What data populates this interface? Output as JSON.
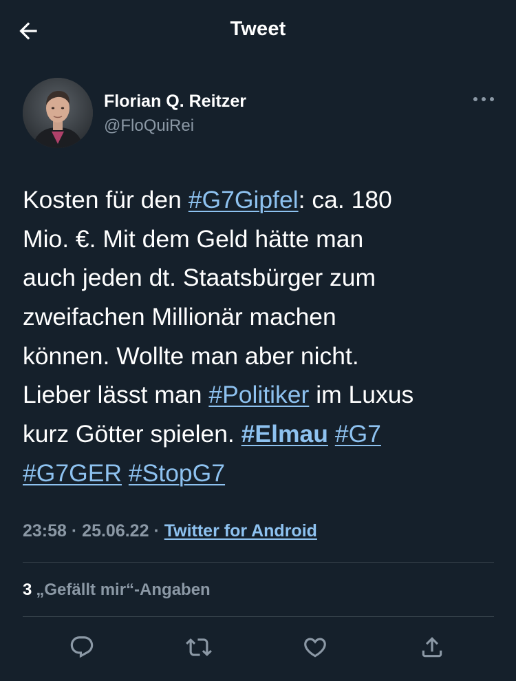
{
  "header": {
    "title": "Tweet",
    "back_icon": "arrow-left-icon"
  },
  "author": {
    "name": "Florian Q. Reitzer",
    "handle": "@FloQuiRei",
    "avatar": "avatar-photo",
    "more_icon": "more-horizontal-icon"
  },
  "tweet": {
    "lines": [
      [
        {
          "t": "text",
          "v": "Kosten für den "
        },
        {
          "t": "tag",
          "v": "#G7Gipfel"
        },
        {
          "t": "text",
          "v": ": ca. 180"
        }
      ],
      [
        {
          "t": "text",
          "v": "Mio. €. Mit dem Geld hätte man"
        }
      ],
      [
        {
          "t": "text",
          "v": "auch jeden dt. Staatsbürger zum"
        }
      ],
      [
        {
          "t": "text",
          "v": "zweifachen Millionär machen"
        }
      ],
      [
        {
          "t": "text",
          "v": "können. Wollte man aber nicht."
        }
      ],
      [
        {
          "t": "text",
          "v": "Lieber lässt man "
        },
        {
          "t": "tag",
          "v": "#Politiker"
        },
        {
          "t": "text",
          "v": " im Luxus"
        }
      ],
      [
        {
          "t": "text",
          "v": "kurz Götter spielen. "
        },
        {
          "t": "tagbold",
          "v": "#Elmau"
        },
        {
          "t": "text",
          "v": " "
        },
        {
          "t": "tag",
          "v": "#G7"
        }
      ],
      [
        {
          "t": "tag",
          "v": "#G7GER"
        },
        {
          "t": "text",
          "v": " "
        },
        {
          "t": "tag",
          "v": "#StopG7"
        }
      ]
    ]
  },
  "meta": {
    "time": "23:58",
    "sep1": " · ",
    "date": "25.06.22",
    "sep2": " · ",
    "source": "Twitter for Android"
  },
  "likes": {
    "count": "3",
    "label": "„Gefällt mir“-Angaben"
  },
  "actions": [
    {
      "name": "reply-icon"
    },
    {
      "name": "retweet-icon"
    },
    {
      "name": "like-icon"
    },
    {
      "name": "share-icon"
    }
  ],
  "colors": {
    "background": "#15202b",
    "link": "#8ec2f0",
    "secondary_text": "#8b98a5",
    "divider": "#38444d"
  }
}
